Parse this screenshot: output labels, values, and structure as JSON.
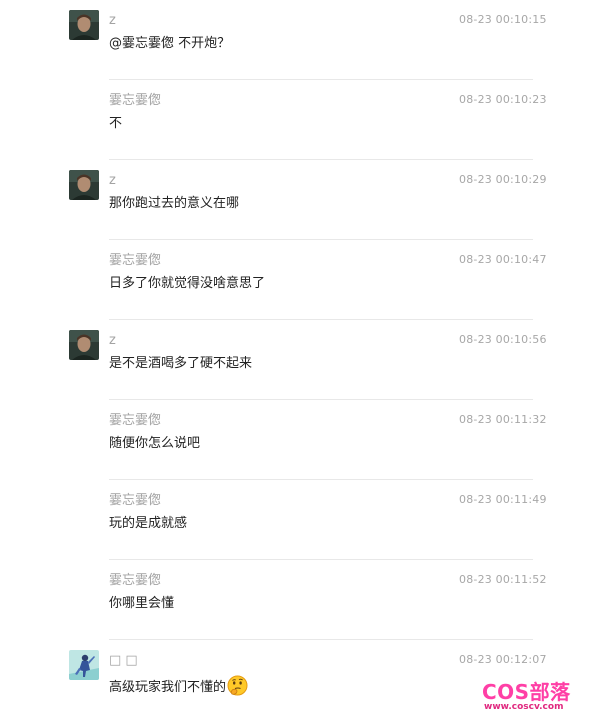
{
  "messages": [
    {
      "name": "z",
      "time": "08-23 00:10:15",
      "text": "@霎忘霎偬 不开炮？",
      "avatar": "dark-portrait"
    },
    {
      "name": "霎忘霎偬",
      "time": "08-23 00:10:23",
      "text": "不",
      "avatar": ""
    },
    {
      "name": "z",
      "time": "08-23 00:10:29",
      "text": "那你跑过去的意义在哪",
      "avatar": "dark-portrait"
    },
    {
      "name": "霎忘霎偬",
      "time": "08-23 00:10:47",
      "text": "日多了你就觉得没啥意思了",
      "avatar": ""
    },
    {
      "name": "z",
      "time": "08-23 00:10:56",
      "text": "是不是酒喝多了硬不起来",
      "avatar": "dark-portrait"
    },
    {
      "name": "霎忘霎偬",
      "time": "08-23 00:11:32",
      "text": "随便你怎么说吧",
      "avatar": ""
    },
    {
      "name": "霎忘霎偬",
      "time": "08-23 00:11:49",
      "text": "玩的是成就感",
      "avatar": ""
    },
    {
      "name": "霎忘霎偬",
      "time": "08-23 00:11:52",
      "text": "你哪里会懂",
      "avatar": ""
    },
    {
      "name": "□ □",
      "time": "08-23 00:12:07",
      "text": "高级玩家我们不懂的",
      "avatar": "anime-figure",
      "emoji": "thinking-face-icon"
    }
  ],
  "watermark": {
    "logo": "COS部落",
    "url": "www.coscv.com"
  },
  "colors": {
    "name": "#a3a3a3",
    "time": "#a7a7a7",
    "text": "#222222",
    "divider": "#e8e8e8",
    "watermark": "#ff3fa6"
  }
}
